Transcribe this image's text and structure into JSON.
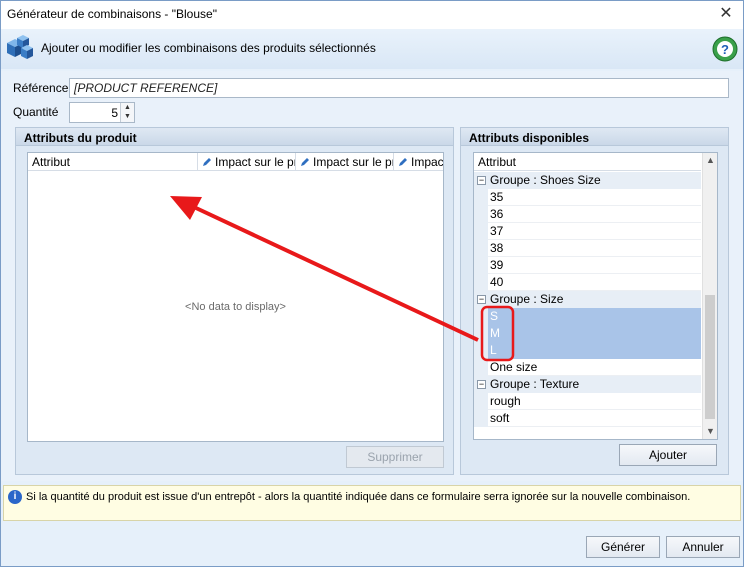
{
  "window": {
    "title": "Générateur de combinaisons - \"Blouse\"",
    "close_glyph": "✕"
  },
  "banner": {
    "description": "Ajouter ou modifier les combinaisons des produits sélectionnés",
    "icon": "cubes-icon",
    "help_icon": "help-icon"
  },
  "form": {
    "reference_label": "Référence",
    "reference_value": "[PRODUCT REFERENCE]",
    "quantity_label": "Quantité",
    "quantity_value": "5"
  },
  "product_attributes": {
    "title": "Attributs du produit",
    "columns": [
      "Attribut",
      "Impact sur le pr",
      "Impact sur le pr",
      "Impac"
    ],
    "empty_text": "<No data to display>",
    "delete_button": "Supprimer"
  },
  "available_attributes": {
    "title": "Attributs disponibles",
    "column": "Attribut",
    "groups": [
      {
        "label": "Groupe : Shoes Size",
        "items": [
          "35",
          "36",
          "37",
          "38",
          "39",
          "40"
        ]
      },
      {
        "label": "Groupe : Size",
        "items": [
          "S",
          "M",
          "L",
          "One size"
        ],
        "selected": [
          "S",
          "M",
          "L"
        ]
      },
      {
        "label": "Groupe : Texture",
        "items": [
          "rough",
          "soft"
        ]
      }
    ],
    "add_button": "Ajouter"
  },
  "info": {
    "icon": "info-icon",
    "message": "Si la quantité du produit est issue d'un entrepôt - alors la quantité indiquée dans ce formulaire serra ignorée sur la nouvelle combinaison."
  },
  "footer": {
    "generate_button": "Générer",
    "cancel_button": "Annuler"
  },
  "colors": {
    "selection": "#a9c4e8",
    "annotation": "#e8191a",
    "window_bg": "#e6f0fa"
  }
}
